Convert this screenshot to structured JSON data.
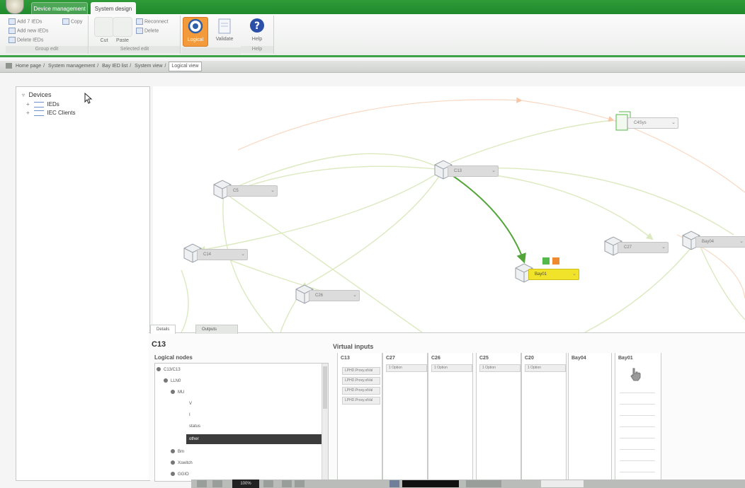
{
  "app": {
    "tabs": [
      {
        "label": "Device management",
        "active": false
      },
      {
        "label": "System design",
        "active": true
      }
    ]
  },
  "ribbon": {
    "group1": {
      "label": "Group edit",
      "commands": [
        "Add 7 IEDs",
        "Add new IEDs",
        "Delete IEDs",
        "Copy"
      ]
    },
    "group2": {
      "label": "Selected edit",
      "commands": [
        "Cut",
        "Paste",
        "Reconnect",
        "Delete"
      ]
    },
    "big_commands": [
      {
        "label": "Logical",
        "selected": true
      },
      {
        "label": "Validate",
        "selected": false
      },
      {
        "label": "Help",
        "selected": false
      }
    ],
    "group3_label": "Help"
  },
  "breadcrumb": {
    "items": [
      "Home page",
      "System management",
      "Bay IED list",
      "System view"
    ],
    "current": "Logical view"
  },
  "devices_tree": {
    "root": "Devices",
    "children": [
      "IEDs",
      "IEC Clients"
    ]
  },
  "diagram": {
    "nodes": [
      {
        "id": "c13",
        "label": "C13",
        "selected": false,
        "style": "normal"
      },
      {
        "id": "c5",
        "label": "C5",
        "selected": false,
        "style": "normal"
      },
      {
        "id": "bay01",
        "label": "Bay01",
        "selected": true,
        "style": "normal"
      },
      {
        "id": "c14",
        "label": "C14",
        "selected": false,
        "style": "normal"
      },
      {
        "id": "c26",
        "label": "C26",
        "selected": false,
        "style": "normal"
      },
      {
        "id": "c27",
        "label": "C27",
        "selected": false,
        "style": "normal"
      },
      {
        "id": "bay04",
        "label": "Bay04",
        "selected": false,
        "style": "normal"
      },
      {
        "id": "c4sys",
        "label": "C4Sys",
        "selected": false,
        "style": "green"
      }
    ],
    "colors": {
      "selected": "#f1e32a",
      "link_active": "#53a53a",
      "link_faint": "#d8e8b8",
      "badge_green": "#55b84a",
      "badge_orange": "#f08a30"
    }
  },
  "bottom_panel": {
    "tabs": [
      "Details",
      "Outputs"
    ],
    "title": "C13",
    "logical_nodes": {
      "header": "Logical nodes",
      "rows": [
        {
          "label": "C13/C13",
          "level": 0,
          "selected": false
        },
        {
          "label": "LLN0",
          "level": 1,
          "selected": false
        },
        {
          "label": "MU",
          "level": 2,
          "selected": false
        },
        {
          "label": "V",
          "level": 3,
          "selected": false
        },
        {
          "label": "I",
          "level": 3,
          "selected": false
        },
        {
          "label": "status",
          "level": 3,
          "selected": false
        },
        {
          "label": "other",
          "level": 3,
          "selected": true
        },
        {
          "label": "Bm",
          "level": 2,
          "selected": false
        },
        {
          "label": "Xswitch",
          "level": 2,
          "selected": false
        },
        {
          "label": "GGIO",
          "level": 2,
          "selected": false
        }
      ]
    },
    "virtual_inputs": {
      "header": "Virtual inputs",
      "columns": [
        {
          "name": "C13",
          "items": [
            "LPHD.Proxy.stVal",
            "LPHD.Proxy.stVal",
            "LPHD.Proxy.stVal",
            "LPHD.Proxy.stVal"
          ]
        },
        {
          "name": "C27",
          "items": [
            "1 Option"
          ]
        },
        {
          "name": "C26",
          "items": [
            "1 Option"
          ]
        },
        {
          "name": "C25",
          "items": [
            "1 Option"
          ]
        },
        {
          "name": "C20",
          "items": [
            "1 Option"
          ]
        },
        {
          "name": "Bay04",
          "items": []
        },
        {
          "name": "Bay01",
          "items": []
        }
      ]
    }
  },
  "taskbar": {
    "zoom": "100%"
  }
}
